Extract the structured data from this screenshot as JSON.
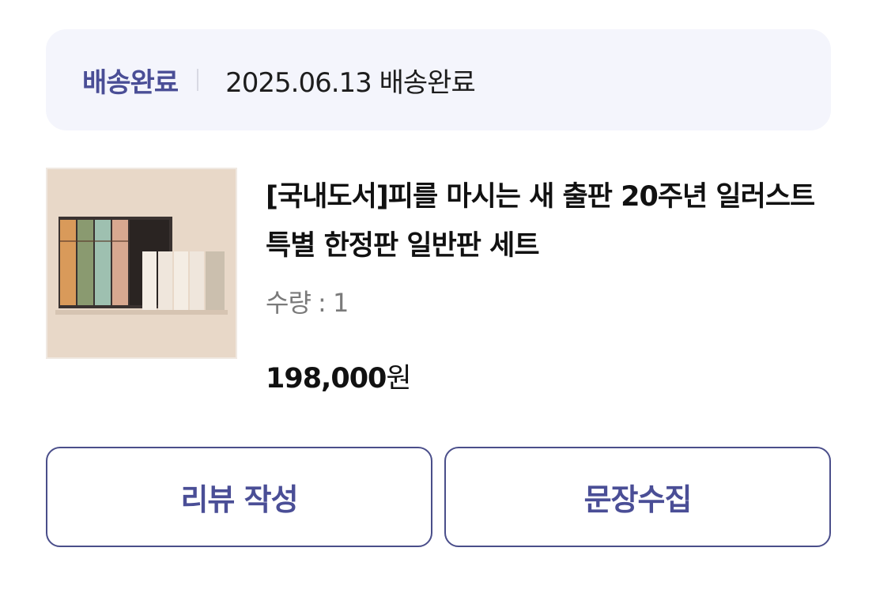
{
  "delivery": {
    "status_label": "배송완료",
    "status_detail": "2025.06.13 배송완료"
  },
  "product": {
    "title": "[국내도서]피를 마시는 새 출판 20주년 일러스트 특별 한정판 일반판 세트",
    "quantity": "수량 : 1",
    "price_number": "198,000",
    "price_unit": "원",
    "image_alt": "피를 마시는 새 세트"
  },
  "actions": {
    "review_label": "리뷰 작성",
    "collect_label": "문장수집"
  },
  "colors": {
    "accent": "#4a4e96",
    "status_bg": "#f4f5fc",
    "thumb_bg": "#e6d6c6"
  }
}
